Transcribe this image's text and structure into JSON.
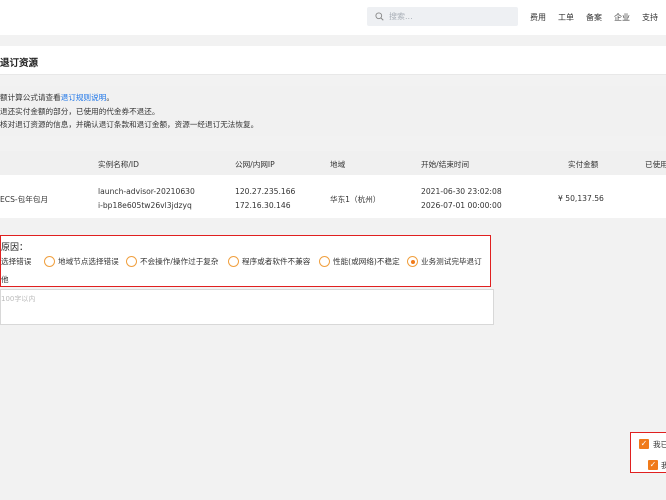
{
  "nav": {
    "search_placeholder": "搜索...",
    "links": [
      "费用",
      "工单",
      "备案",
      "企业",
      "支持"
    ]
  },
  "page": {
    "title": "退订资源"
  },
  "notice": {
    "line1_prefix": "额计算公式请查看",
    "line1_link": "退订规则说明",
    "line1_suffix": "。",
    "line2": "退还实付金额的部分，已使用的代金券不退还。",
    "line3": "核对退订资源的信息，并确认退订条款和退订金额，资源一经退订无法恢复。"
  },
  "table": {
    "headers": [
      "",
      "实例名称/ID",
      "公网/内网IP",
      "地域",
      "开始/结束时间",
      "实付金额",
      "已使用"
    ],
    "row": {
      "product": "ECS-包年包月",
      "instance_name": "launch-advisor-20210630",
      "instance_id": "i-bp18e605tw26vl3jdzyq",
      "public_ip": "120.27.235.166",
      "private_ip": "172.16.30.146",
      "region": "华东1（杭州）",
      "start_time": "2021-06-30 23:02:08",
      "end_time": "2026-07-01 00:00:00",
      "amount": "¥ 50,137.56"
    }
  },
  "reasons": {
    "title": "原因：",
    "options": [
      "选择错误",
      "地域节点选择错误",
      "不会操作/操作过于复杂",
      "程序或者软件不兼容",
      "性能(或网络)不稳定",
      "业务测试完毕退订"
    ],
    "selected_index": 5,
    "remark_label": "他",
    "placeholder": "100字以内"
  },
  "confirm": {
    "item1": "我已",
    "item2": "我"
  }
}
